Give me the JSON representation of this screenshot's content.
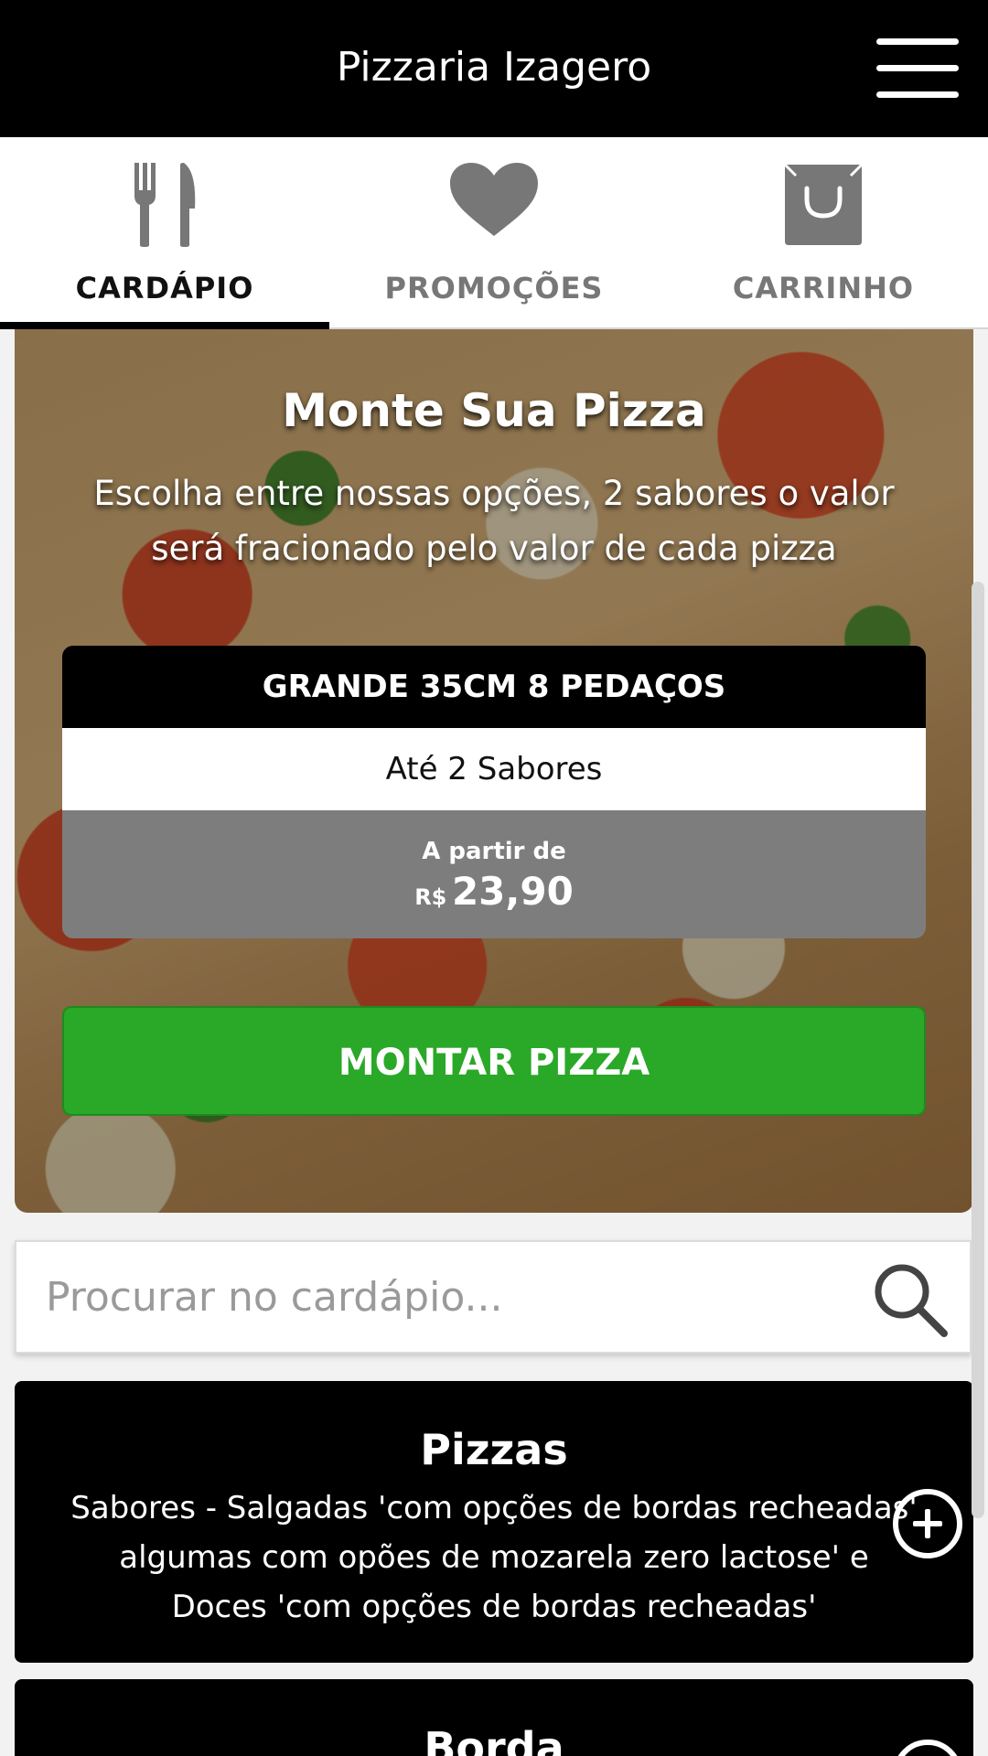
{
  "header": {
    "title": "Pizzaria Izagero",
    "menu_icon": "hamburger-menu-icon"
  },
  "tabs": [
    {
      "label": "CARDÁPIO",
      "icon": "fork-knife-icon",
      "active": true
    },
    {
      "label": "PROMOÇÕES",
      "icon": "heart-icon",
      "active": false
    },
    {
      "label": "CARRINHO",
      "icon": "shopping-bag-icon",
      "active": false
    }
  ],
  "hero": {
    "title": "Monte Sua Pizza",
    "description": "Escolha entre nossas opções, 2 sabores o valor será fracionado pelo valor de cada pizza",
    "size_card": {
      "size": "GRANDE 35CM 8 PEDAÇOS",
      "flavors": "Até 2 Sabores",
      "from_label": "A partir de",
      "currency": "R$",
      "price": "23,90"
    },
    "build_button": "MONTAR PIZZA"
  },
  "search": {
    "placeholder": "Procurar no cardápio...",
    "icon": "search-icon"
  },
  "categories": [
    {
      "name": "Pizzas",
      "description": "Sabores - Salgadas 'com opções de bordas recheadas' algumas com opões de mozarela zero lactose' e Doces 'com opções de bordas recheadas'"
    },
    {
      "name": "Borda",
      "description": ""
    }
  ],
  "colors": {
    "header_bg": "#000000",
    "button_green": "#2aa828",
    "price_bg": "#7d7d7d",
    "inactive_tab": "#777777"
  }
}
